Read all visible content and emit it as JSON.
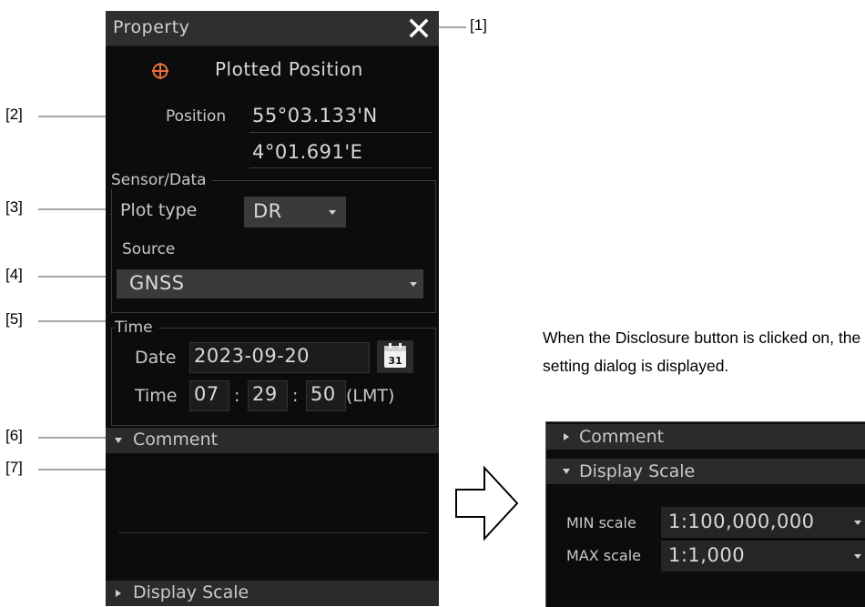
{
  "callouts": [
    "[1]",
    "[2]",
    "[3]",
    "[4]",
    "[5]",
    "[6]",
    "[7]"
  ],
  "panel": {
    "title": "Property",
    "close_icon": "close-icon",
    "object_icon": "plotted-position-icon",
    "object_type": "Plotted Position",
    "position_label": "Position",
    "latitude": "55°03.133'N",
    "longitude": "4°01.691'E",
    "sensor_group_label": "Sensor/Data",
    "plot_type_label": "Plot type",
    "plot_type_value": "DR",
    "source_label": "Source",
    "source_value": "GNSS",
    "time_group_label": "Time",
    "date_label": "Date",
    "date_value": "2023-09-20",
    "calendar_icon": "calendar-icon",
    "calendar_day": "31",
    "time_label": "Time",
    "hour": "07",
    "minute": "29",
    "second": "50",
    "colon": ":",
    "timezone": "(LMT)",
    "comment_label": "Comment",
    "display_scale_label": "Display Scale",
    "accent_color": "#e8703a"
  },
  "note": {
    "text": "When the Disclosure button is clicked on, the setting dialog is displayed."
  },
  "expanded_panel": {
    "comment_label": "Comment",
    "display_scale_label": "Display Scale",
    "min_scale_label": "MIN scale",
    "min_scale_value": "1:100,000,000",
    "max_scale_label": "MAX scale",
    "max_scale_value": "1:1,000"
  }
}
